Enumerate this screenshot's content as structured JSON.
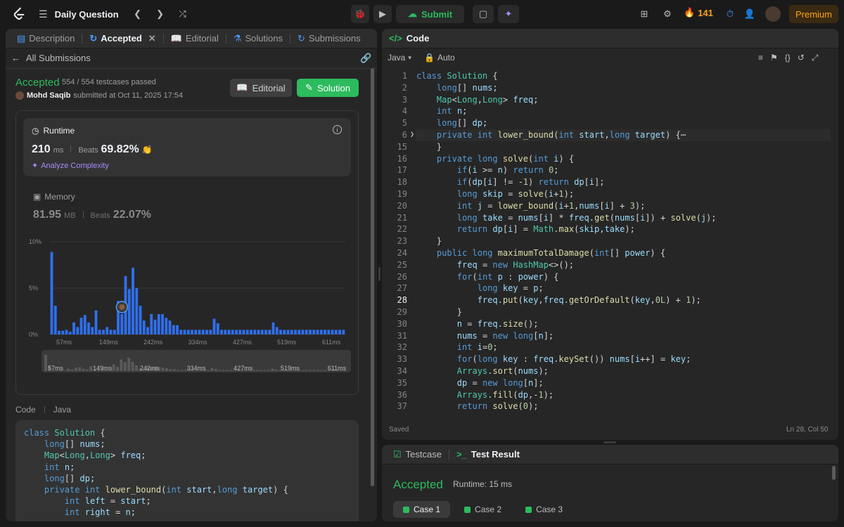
{
  "topbar": {
    "title": "Daily Question",
    "submit_label": "Submit",
    "streak_count": "141",
    "premium_label": "Premium"
  },
  "left_tabs": [
    {
      "label": "Description",
      "icon": "document-icon",
      "active": false
    },
    {
      "label": "Accepted",
      "icon": "history-icon",
      "active": true
    },
    {
      "label": "Editorial",
      "icon": "book-icon",
      "active": false
    },
    {
      "label": "Solutions",
      "icon": "flask-icon",
      "active": false
    },
    {
      "label": "Submissions",
      "icon": "history-icon",
      "active": false
    }
  ],
  "submission": {
    "all_submissions_label": "All Submissions",
    "status": "Accepted",
    "testcases": "554 / 554 testcases passed",
    "user": "Mohd Saqib",
    "submitted_text": "submitted at Oct 11, 2025 17:54",
    "editorial_label": "Editorial",
    "solution_label": "Solution"
  },
  "runtime": {
    "title": "Runtime",
    "value": "210",
    "unit": "ms",
    "beats_label": "Beats",
    "beats_value": "69.82%",
    "analyze_label": "Analyze Complexity"
  },
  "memory": {
    "title": "Memory",
    "value": "81.95",
    "unit": "MB",
    "beats_label": "Beats",
    "beats_value": "22.07%"
  },
  "chart_data": {
    "type": "bar",
    "y_ticks": [
      "10%",
      "5%",
      "0%"
    ],
    "ylim": [
      0,
      10
    ],
    "x_ticks": [
      "57ms",
      "149ms",
      "242ms",
      "334ms",
      "427ms",
      "519ms",
      "611ms"
    ],
    "values": [
      8.9,
      3.1,
      0.4,
      0.4,
      0.5,
      0.3,
      1.3,
      0.8,
      1.8,
      2.1,
      1.3,
      0.8,
      2.6,
      0.5,
      0.5,
      0.8,
      0.5,
      0.5,
      3.6,
      2.2,
      6.3,
      4.9,
      7.2,
      5.0,
      3.1,
      1.5,
      0.8,
      2.2,
      1.6,
      2.2,
      2.2,
      1.8,
      1.5,
      1.0,
      1.0,
      0.5,
      0.5,
      0.5,
      0.5,
      0.5,
      0.5,
      0.5,
      0.5,
      0.5,
      1.7,
      1.2,
      0.5,
      0.5,
      0.5,
      0.5,
      0.5,
      0.5,
      0.5,
      0.5,
      0.5,
      0.5,
      0.5,
      0.5,
      0.5,
      0.5,
      1.3,
      0.8,
      0.5,
      0.5,
      0.5,
      0.5,
      0.5,
      0.5,
      0.5,
      0.5,
      0.5,
      0.5,
      0.5,
      0.5,
      0.5,
      0.5,
      0.5,
      0.5,
      0.5,
      0.5
    ],
    "highlight_index": 19
  },
  "code_section": {
    "label": "Code",
    "lang": "Java",
    "lines": [
      "class Solution {",
      "    long[] nums;",
      "    Map<Long,Long> freq;",
      "    int n;",
      "    long[] dp;",
      "    private int lower_bound(int start,long target) {",
      "        int left = start;",
      "        int right = n;"
    ]
  },
  "editor": {
    "tab_label": "Code",
    "language": "Java",
    "mode": "Auto",
    "saved_label": "Saved",
    "cursor_pos": "Ln 28, Col 50",
    "line_numbers": [
      "1",
      "2",
      "3",
      "4",
      "5",
      "6",
      "15",
      "16",
      "17",
      "18",
      "19",
      "20",
      "21",
      "22",
      "23",
      "24",
      "25",
      "26",
      "27",
      "28",
      "29",
      "30",
      "31",
      "32",
      "33",
      "34",
      "35",
      "36",
      "37"
    ],
    "lines": [
      "class Solution {",
      "    long[] nums;",
      "    Map<Long,Long> freq;",
      "    int n;",
      "    long[] dp;",
      "    private int lower_bound(int start,long target) {⋯",
      "    }",
      "    private long solve(int i) {",
      "        if(i >= n) return 0;",
      "        if(dp[i] != -1) return dp[i];",
      "        long skip = solve(i+1);",
      "        int j = lower_bound(i+1,nums[i] + 3);",
      "        long take = nums[i] * freq.get(nums[i]) + solve(j);",
      "        return dp[i] = Math.max(skip,take);",
      "    }",
      "    public long maximumTotalDamage(int[] power) {",
      "        freq = new HashMap<>();",
      "        for(int p : power) {",
      "            long key = p;",
      "            freq.put(key,freq.getOrDefault(key,0L) + 1);",
      "        }",
      "        n = freq.size();",
      "        nums = new long[n];",
      "        int i=0;",
      "        for(long key : freq.keySet()) nums[i++] = key;",
      "        Arrays.sort(nums);",
      "        dp = new long[n];",
      "        Arrays.fill(dp,-1);",
      "        return solve(0);"
    ]
  },
  "bottom": {
    "testcase_label": "Testcase",
    "result_label": "Test Result",
    "status": "Accepted",
    "runtime": "Runtime: 15 ms",
    "cases": [
      "Case 1",
      "Case 2",
      "Case 3"
    ]
  },
  "colors": {
    "accent_green": "#2cbb5d",
    "accent_orange": "#ffa116",
    "bar_blue": "#2f6fed"
  }
}
